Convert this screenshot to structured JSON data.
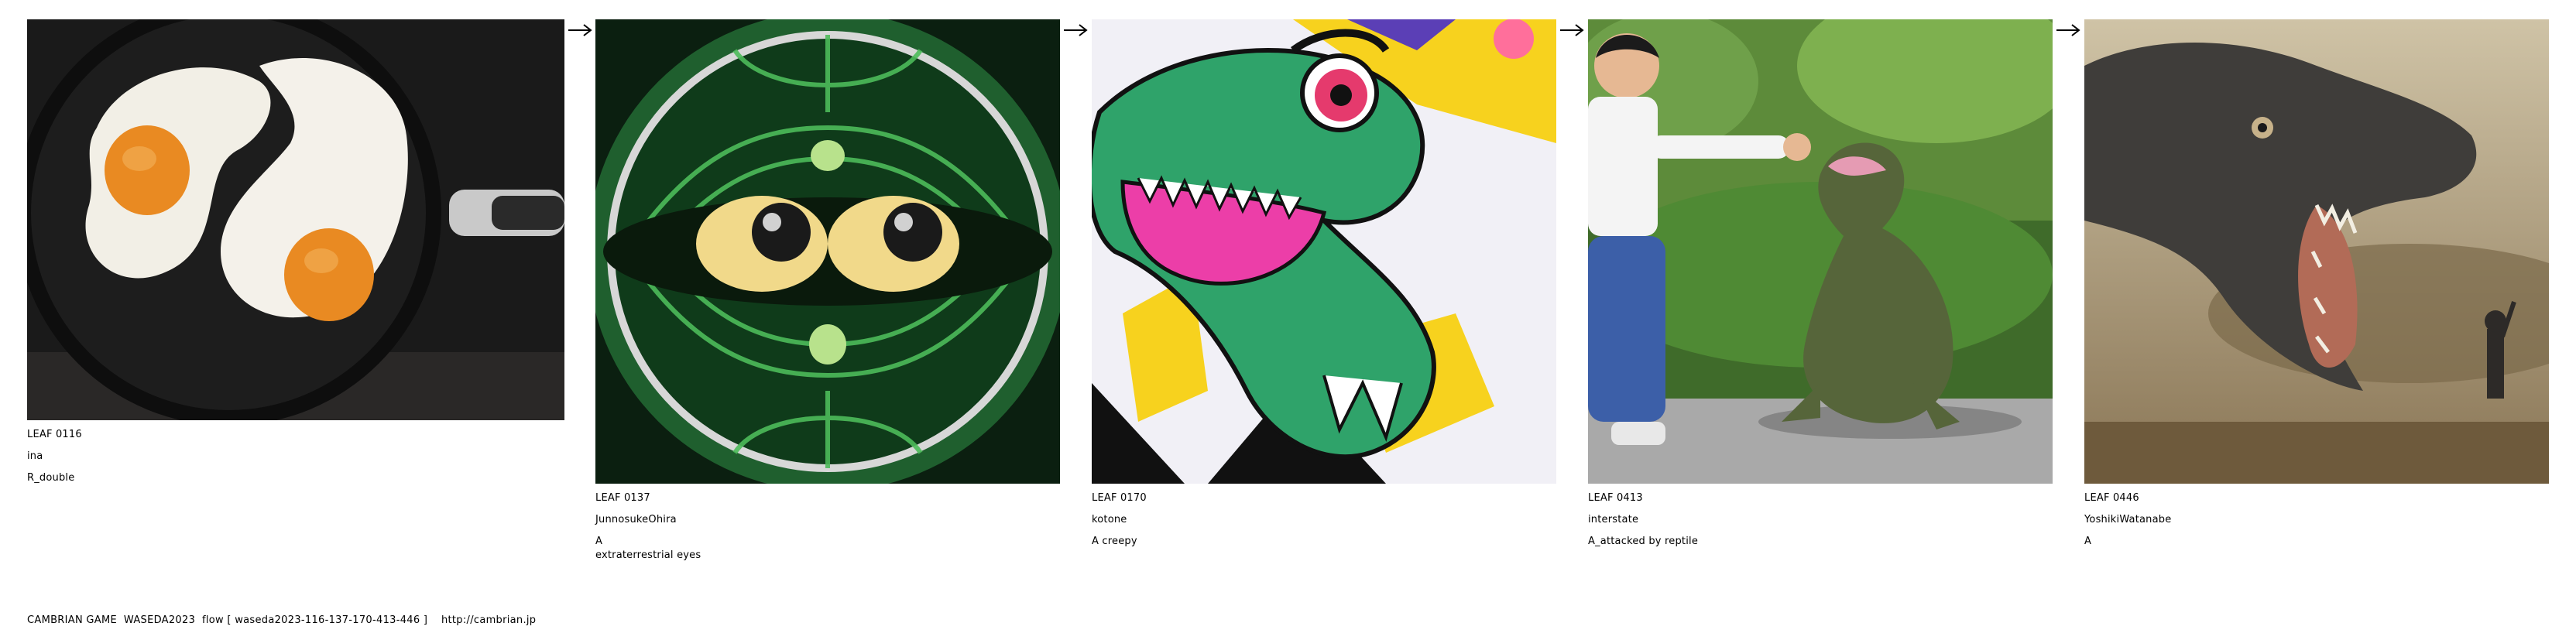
{
  "leaves": [
    {
      "id": "LEAF 0116",
      "author": "ina",
      "caption": [
        "R_double"
      ],
      "image": "fried-eggs-in-pan"
    },
    {
      "id": "LEAF 0137",
      "author": "JunnosukeOhira",
      "caption": [
        "A",
        "extraterrestrial eyes"
      ],
      "image": "green-alien-eyes"
    },
    {
      "id": "LEAF 0170",
      "author": "kotone",
      "caption": [
        "A creepy"
      ],
      "image": "cartoon-dinosaur"
    },
    {
      "id": "LEAF 0413",
      "author": "interstate",
      "caption": [
        "A_attacked by reptile"
      ],
      "image": "boy-and-reptile"
    },
    {
      "id": "LEAF 0446",
      "author": "YoshikiWatanabe",
      "caption": [
        "A"
      ],
      "image": "giant-dinosaur-and-child"
    }
  ],
  "footer": {
    "text": "CAMBRIAN GAME  WASEDA2023  flow [ waseda2023-116-137-170-413-446 ]    http://cambrian.jp"
  },
  "colors": {
    "background": "#ffffff",
    "text": "#000000"
  }
}
